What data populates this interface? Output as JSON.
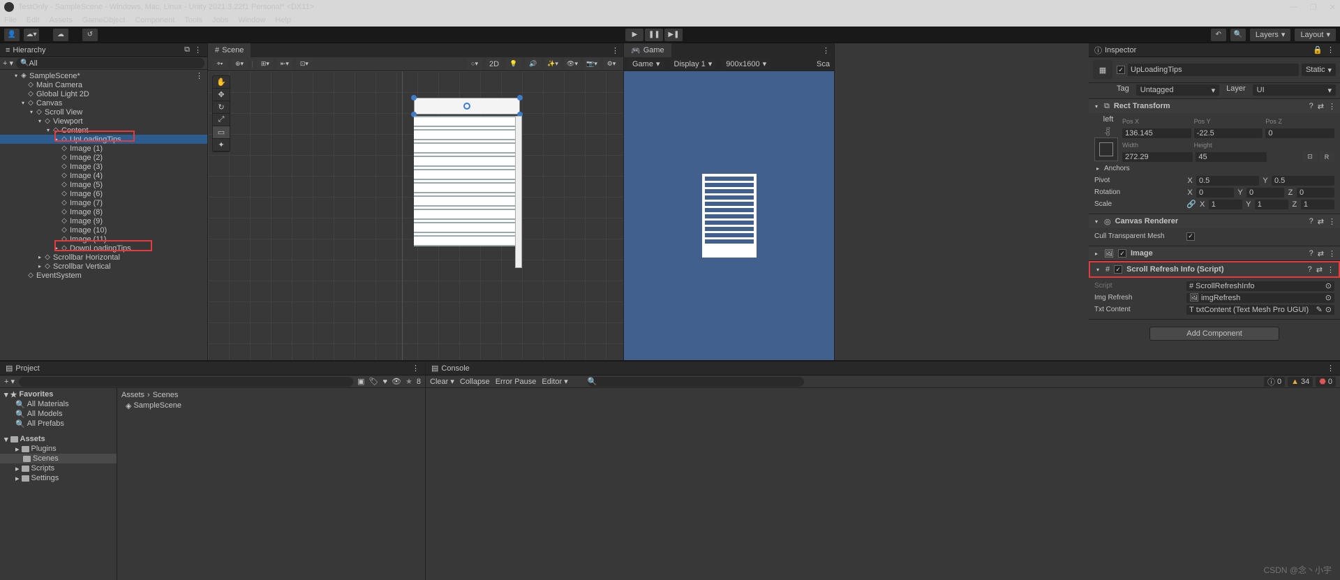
{
  "title": "TestOnly - SampleScene - Windows, Mac, Linux - Unity 2021.3.22f1 Personal* <DX11>",
  "menus": [
    "File",
    "Edit",
    "Assets",
    "GameObject",
    "Component",
    "Tools",
    "Jobs",
    "Window",
    "Help"
  ],
  "toolbar": {
    "layers": "Layers",
    "layout": "Layout"
  },
  "hierarchy": {
    "title": "Hierarchy",
    "search_placeholder": "All",
    "scene": "SampleScene*",
    "items": [
      "Main Camera",
      "Global Light 2D",
      "Canvas",
      "Scroll View",
      "Viewport",
      "Content",
      "UpLoadingTips",
      "Image (1)",
      "Image (2)",
      "Image (3)",
      "Image (4)",
      "Image (5)",
      "Image (6)",
      "Image (7)",
      "Image (8)",
      "Image (9)",
      "Image (10)",
      "Image (11)",
      "DownLoadingTips",
      "Scrollbar Horizontal",
      "Scrollbar Vertical",
      "EventSystem"
    ]
  },
  "scene": {
    "tab": "Scene",
    "btn2d": "2D"
  },
  "game": {
    "tab": "Game",
    "mode": "Game",
    "display": "Display 1",
    "res": "900x1600",
    "scale_label": "Sca"
  },
  "inspector": {
    "title": "Inspector",
    "name": "UpLoadingTips",
    "static_label": "Static",
    "tag_label": "Tag",
    "tag_value": "Untagged",
    "layer_label": "Layer",
    "layer_value": "UI",
    "rect": {
      "title": "Rect Transform",
      "left_label": "left",
      "top_label": "top",
      "posx_label": "Pos X",
      "posy_label": "Pos Y",
      "posz_label": "Pos Z",
      "posx": "136.145",
      "posy": "-22.5",
      "posz": "0",
      "width_label": "Width",
      "height_label": "Height",
      "width": "272.29",
      "height": "45",
      "anchors_label": "Anchors",
      "pivot_label": "Pivot",
      "pivot_x": "0.5",
      "pivot_y": "0.5",
      "rotation_label": "Rotation",
      "rot_x": "0",
      "rot_y": "0",
      "rot_z": "0",
      "scale_label": "Scale",
      "scale_x": "1",
      "scale_y": "1",
      "scale_z": "1"
    },
    "canvas_renderer": {
      "title": "Canvas Renderer",
      "cull_label": "Cull Transparent Mesh"
    },
    "image": {
      "title": "Image"
    },
    "script": {
      "title": "Scroll Refresh Info (Script)",
      "script_label": "Script",
      "script_value": "ScrollRefreshInfo",
      "img_label": "Img Refresh",
      "img_value": "imgRefresh",
      "txt_label": "Txt Content",
      "txt_value": "txtContent (Text Mesh Pro UGUI)"
    },
    "add_component": "Add Component"
  },
  "project": {
    "tab": "Project",
    "favorites": "Favorites",
    "fav_items": [
      "All Materials",
      "All Models",
      "All Prefabs"
    ],
    "assets": "Assets",
    "folders": [
      "Plugins",
      "Scenes",
      "Scripts",
      "Settings"
    ],
    "crumb1": "Assets",
    "crumb2": "Scenes",
    "scene_item": "SampleScene",
    "star_count": "8"
  },
  "console": {
    "tab": "Console",
    "clear": "Clear",
    "collapse": "Collapse",
    "error_pause": "Error Pause",
    "editor": "Editor",
    "info_count": "0",
    "warn_count": "34",
    "err_count": "0"
  },
  "watermark": "CSDN @念丶小宇"
}
